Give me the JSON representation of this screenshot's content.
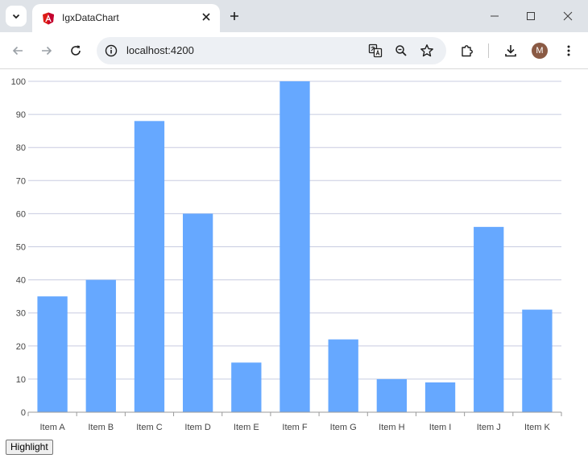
{
  "browser": {
    "tab_title": "IgxDataChart",
    "url": "localhost:4200",
    "avatar_letter": "M",
    "colors": {
      "tab_strip": "#dfe3e8",
      "omnibox": "#edf0f4",
      "angular_red": "#dd1b16"
    }
  },
  "page": {
    "highlight_button_label": "Highlight"
  },
  "chart_data": {
    "type": "bar",
    "categories": [
      "Item A",
      "Item B",
      "Item C",
      "Item D",
      "Item E",
      "Item F",
      "Item G",
      "Item H",
      "Item I",
      "Item J",
      "Item K"
    ],
    "values": [
      35,
      40,
      88,
      60,
      15,
      100,
      22,
      10,
      9,
      56,
      31
    ],
    "ylim": [
      0,
      100
    ],
    "yticks": [
      0,
      10,
      20,
      30,
      40,
      50,
      60,
      70,
      80,
      90,
      100
    ],
    "grid": true,
    "bar_color": "#66a8ff",
    "grid_color": "#c8cce0",
    "tick_label_color": "#444444"
  }
}
